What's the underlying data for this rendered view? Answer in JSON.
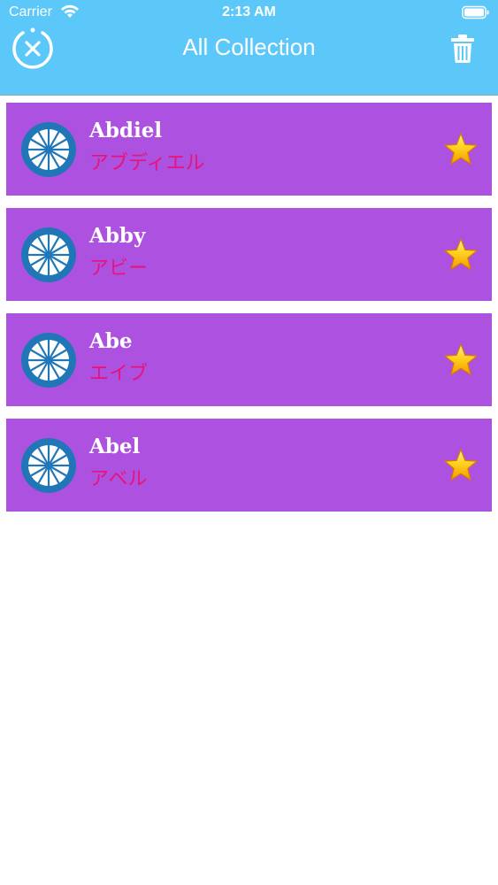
{
  "status_bar": {
    "carrier": "Carrier",
    "time": "2:13 AM"
  },
  "header": {
    "title": "All Collection",
    "close_icon": "close-circle-icon",
    "delete_icon": "trash-icon",
    "background_color": "#5bc8f9"
  },
  "collection": {
    "item_color": "#ad52e0",
    "kana_color": "#e8137a",
    "items": [
      {
        "name": "Abdiel",
        "kana": "アブディエル",
        "favorite": true
      },
      {
        "name": "Abby",
        "kana": "アビー",
        "favorite": true
      },
      {
        "name": "Abe",
        "kana": "エイブ",
        "favorite": true
      },
      {
        "name": "Abel",
        "kana": "アベル",
        "favorite": true
      }
    ]
  }
}
